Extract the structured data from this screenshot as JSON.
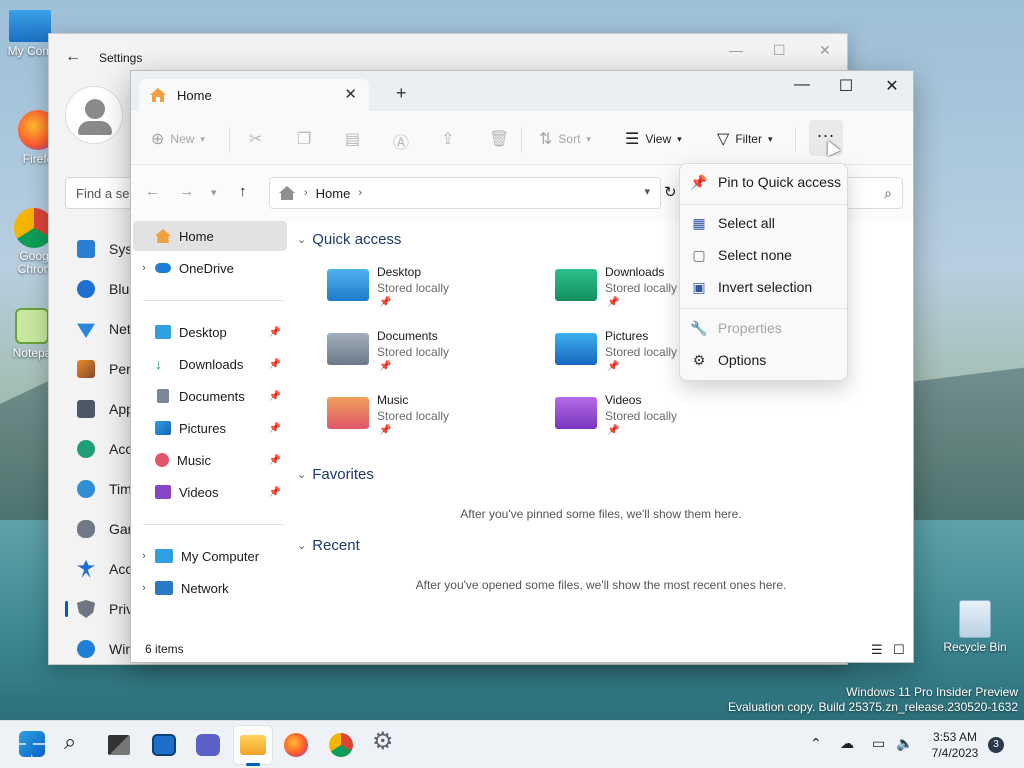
{
  "desktop": {
    "icons": [
      {
        "label": "My Com"
      },
      {
        "label": "Firefo"
      },
      {
        "label": "Goog Chron"
      },
      {
        "label": "Notepa"
      },
      {
        "label": "Recycle Bin"
      }
    ],
    "watermark_line1": "Windows 11 Pro Insider Preview",
    "watermark_line2": "Evaluation copy. Build 25375.zn_release.230520-1632"
  },
  "settings": {
    "title": "Settings",
    "search_placeholder": "Find a se",
    "nav": [
      "Syst",
      "Blue",
      "Net",
      "Pers",
      "App",
      "Acc",
      "Tim",
      "Gan",
      "Acc",
      "Priv",
      "Win"
    ]
  },
  "explorer": {
    "tab_label": "Home",
    "toolbar": {
      "new_label": "New",
      "sort_label": "Sort",
      "view_label": "View",
      "filter_label": "Filter",
      "more_label": "..."
    },
    "address": {
      "crumb": "Home"
    },
    "sidebar": {
      "home": "Home",
      "onedrive": "OneDrive",
      "desktop": "Desktop",
      "downloads": "Downloads",
      "documents": "Documents",
      "pictures": "Pictures",
      "music": "Music",
      "videos": "Videos",
      "my_computer": "My Computer",
      "network": "Network"
    },
    "sections": {
      "quick_access": "Quick access",
      "favorites": "Favorites",
      "recent": "Recent"
    },
    "quick_items": [
      {
        "name": "Desktop",
        "sub": "Stored locally"
      },
      {
        "name": "Downloads",
        "sub": "Stored locally"
      },
      {
        "name": "Documents",
        "sub": "Stored locally"
      },
      {
        "name": "Pictures",
        "sub": "Stored locally"
      },
      {
        "name": "Music",
        "sub": "Stored locally"
      },
      {
        "name": "Videos",
        "sub": "Stored locally"
      }
    ],
    "favorites_empty": "After you've pinned some files, we'll show them here.",
    "recent_empty": "After you've opened some files, we'll show the most recent ones here.",
    "status_count": "6 items"
  },
  "menu": {
    "pin": "Pin to Quick access",
    "select_all": "Select all",
    "select_none": "Select none",
    "invert": "Invert selection",
    "properties": "Properties",
    "options": "Options"
  },
  "taskbar": {
    "time": "3:53 AM",
    "date": "7/4/2023",
    "notifications": "3"
  },
  "colors": {
    "accent": "#005fb8",
    "section_heading": "#1c3a6e"
  }
}
